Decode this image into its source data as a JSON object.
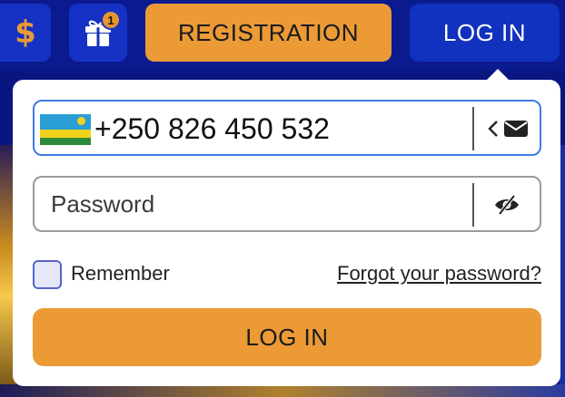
{
  "header": {
    "currency_symbol": "$",
    "gift_icon": "gift-icon",
    "gift_badge_count": "1",
    "registration_label": "REGISTRATION",
    "login_label": "LOG IN"
  },
  "login_form": {
    "phone": {
      "country_flag": "rwanda-flag-icon",
      "value": "+250 826 450 532",
      "switch_icon": "chevron-envelope-icon"
    },
    "password": {
      "placeholder": "Password",
      "toggle_icon": "eye-slash-icon"
    },
    "remember_label": "Remember",
    "remember_checked": false,
    "forgot_label": "Forgot your password?",
    "submit_label": "LOG IN"
  },
  "colors": {
    "accent_orange": "#eb9a36",
    "header_bg": "#0b1a8f",
    "button_blue": "#1131bf",
    "input_focus_border": "#3f7be6"
  }
}
